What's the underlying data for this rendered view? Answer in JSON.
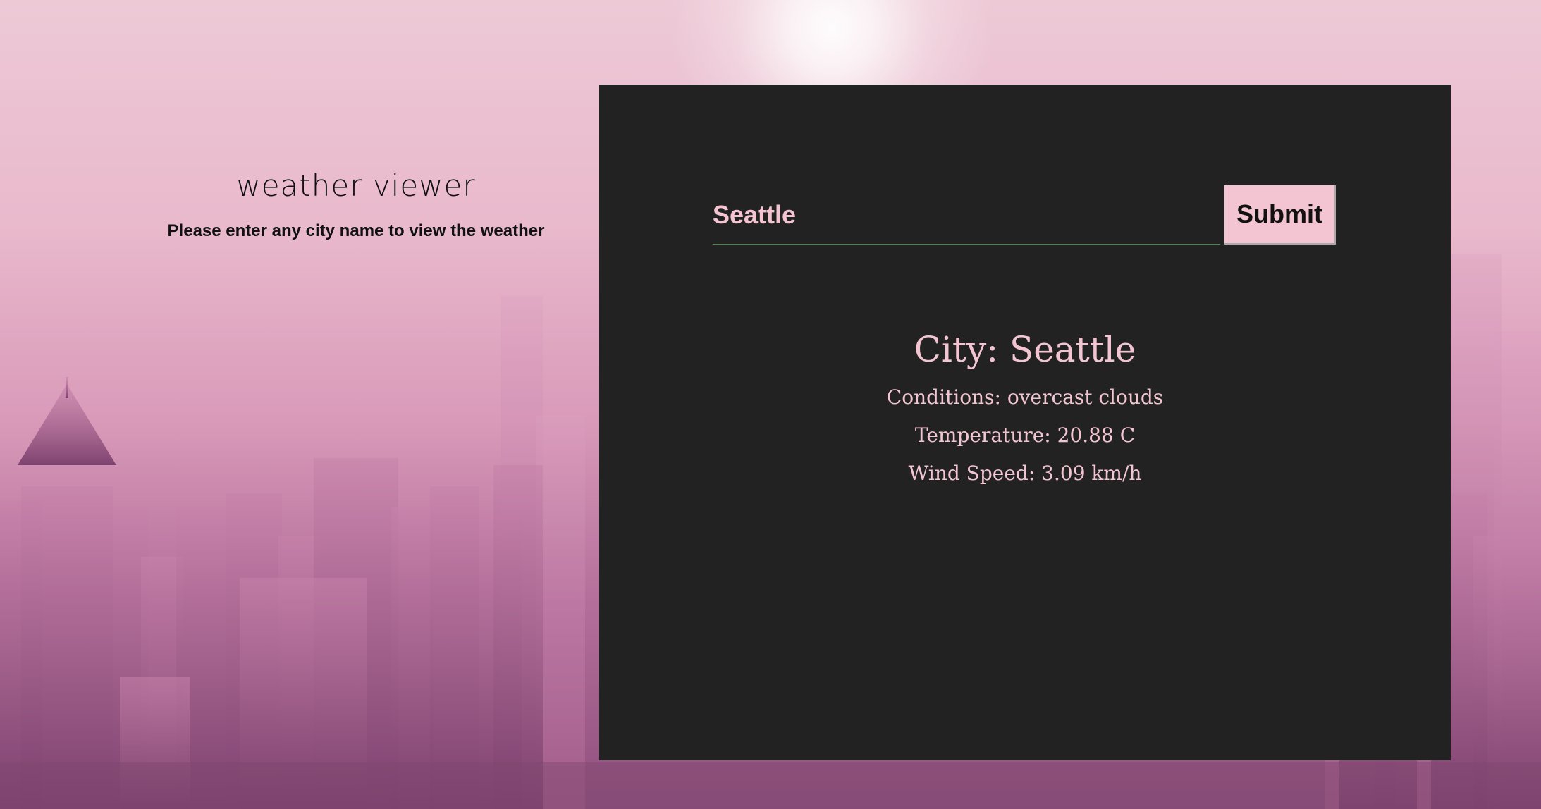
{
  "colors": {
    "background_pink": "#e9b9cc",
    "card_background": "#222222",
    "accent_pink": "#f3c4d1",
    "input_underline": "#3c8f47",
    "dark_text": "#111111"
  },
  "header": {
    "title": "weather viewer",
    "subtitle": "Please enter any city name to view the weather"
  },
  "search": {
    "value": "Seattle",
    "placeholder": ""
  },
  "buttons": {
    "submit_label": "Submit"
  },
  "results": {
    "city": "City: Seattle",
    "conditions": "Conditions: overcast clouds",
    "temperature": "Temperature: 20.88 C",
    "wind_speed": "Wind Speed: 3.09 km/h"
  }
}
